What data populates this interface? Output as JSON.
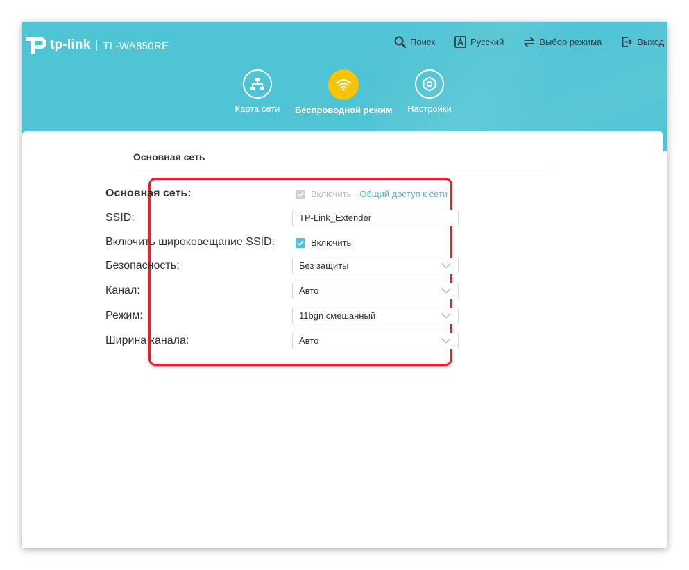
{
  "brand": {
    "logo_text": "tp-link",
    "model": "TL-WA850RE"
  },
  "top_nav": {
    "search": "Поиск",
    "language": "Русский",
    "mode": "Выбор режима",
    "logout": "Выход"
  },
  "modes": [
    {
      "label": "Карта сети",
      "icon": "network-map-icon",
      "active": false
    },
    {
      "label": "Беспроводной режим",
      "icon": "wifi-icon",
      "active": true
    },
    {
      "label": "Настройки",
      "icon": "settings-icon",
      "active": false
    }
  ],
  "section": {
    "title": "Основная сеть"
  },
  "form": {
    "main_network": {
      "label": "Основная сеть:",
      "checkbox_label": "Включить",
      "checked": true,
      "disabled": true,
      "link": "Общий доступ к сети"
    },
    "ssid": {
      "label": "SSID:",
      "value": "TP-Link_Extender"
    },
    "broadcast": {
      "label": "Включить широковещание SSID:",
      "checkbox_label": "Включить",
      "checked": true
    },
    "security": {
      "label": "Безопасность:",
      "value": "Без защиты"
    },
    "channel": {
      "label": "Канал:",
      "value": "Авто"
    },
    "mode": {
      "label": "Режим:",
      "value": "11bgn смешанный"
    },
    "width": {
      "label": "Ширина канала:",
      "value": "Авто"
    }
  },
  "colors": {
    "header": "#4fc4d4",
    "accent": "#4fc4d4",
    "active_mode": "#f6c400",
    "highlight": "#e8202a",
    "link": "#4fb7c6"
  }
}
